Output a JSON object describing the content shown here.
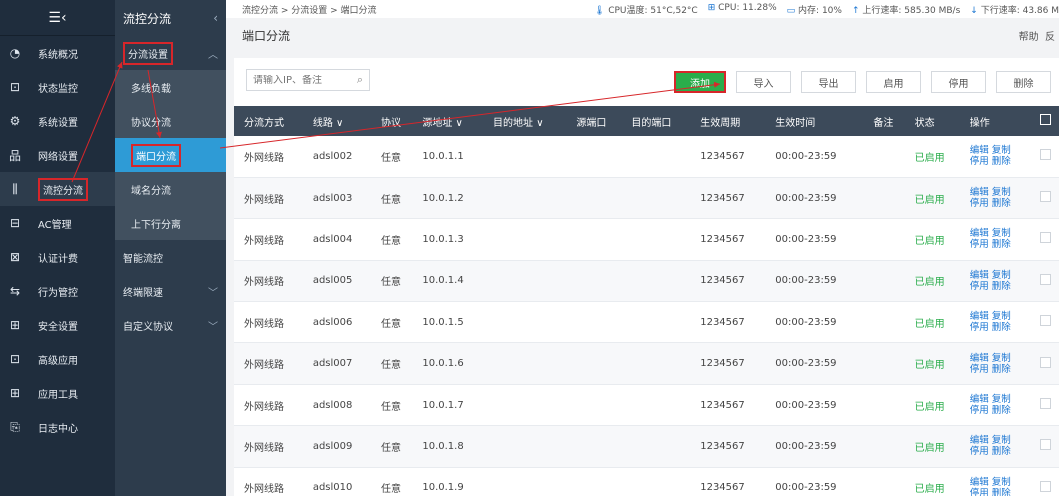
{
  "sidebar": {
    "menu_icon": "collapse-menu-icon",
    "items": [
      {
        "label": "系统概况",
        "icon": "dashboard-icon"
      },
      {
        "label": "状态监控",
        "icon": "monitor-icon"
      },
      {
        "label": "系统设置",
        "icon": "gear-icon"
      },
      {
        "label": "网络设置",
        "icon": "network-icon"
      },
      {
        "label": "流控分流",
        "icon": "flow-control-icon"
      },
      {
        "label": "AC管理",
        "icon": "ac-icon"
      },
      {
        "label": "认证计费",
        "icon": "auth-icon"
      },
      {
        "label": "行为管控",
        "icon": "behavior-icon"
      },
      {
        "label": "安全设置",
        "icon": "security-icon"
      },
      {
        "label": "高级应用",
        "icon": "advanced-icon"
      },
      {
        "label": "应用工具",
        "icon": "tools-icon"
      },
      {
        "label": "日志中心",
        "icon": "log-icon"
      }
    ]
  },
  "subnav": {
    "title": "流控分流",
    "section1": "分流设置",
    "sub_items": [
      "多线负载",
      "协议分流",
      "端口分流",
      "域名分流",
      "上下行分离"
    ],
    "section2": "智能流控",
    "section3": "终端限速",
    "section4": "自定义协议"
  },
  "topbar": {
    "breadcrumb": "流控分流 > 分流设置 > 端口分流",
    "cpu_temp": "CPU温度: 51°C,52°C",
    "cpu": "CPU: 11.28%",
    "mem": "内存: 10%",
    "up": "上行速率: 585.30 MB/s",
    "down": "下行速率: 43.86 M"
  },
  "title": "端口分流",
  "help": "帮助",
  "help_tail": "反",
  "search": {
    "placeholder": "请输入IP、备注"
  },
  "buttons": {
    "add": "添加",
    "import": "导入",
    "export": "导出",
    "enable": "启用",
    "disable": "停用",
    "delete": "删除"
  },
  "columns": [
    "分流方式",
    "线路 ∨",
    "协议",
    "源地址 ∨",
    "目的地址 ∨",
    "源端口",
    "目的端口",
    "生效周期",
    "生效时间",
    "备注",
    "状态",
    "操作"
  ],
  "rows": [
    {
      "mode": "外网线路",
      "line": "adsl002",
      "proto": "任意",
      "src": "10.0.1.1",
      "period": "1234567",
      "time": "00:00-23:59",
      "status": "已启用"
    },
    {
      "mode": "外网线路",
      "line": "adsl003",
      "proto": "任意",
      "src": "10.0.1.2",
      "period": "1234567",
      "time": "00:00-23:59",
      "status": "已启用"
    },
    {
      "mode": "外网线路",
      "line": "adsl004",
      "proto": "任意",
      "src": "10.0.1.3",
      "period": "1234567",
      "time": "00:00-23:59",
      "status": "已启用"
    },
    {
      "mode": "外网线路",
      "line": "adsl005",
      "proto": "任意",
      "src": "10.0.1.4",
      "period": "1234567",
      "time": "00:00-23:59",
      "status": "已启用"
    },
    {
      "mode": "外网线路",
      "line": "adsl006",
      "proto": "任意",
      "src": "10.0.1.5",
      "period": "1234567",
      "time": "00:00-23:59",
      "status": "已启用"
    },
    {
      "mode": "外网线路",
      "line": "adsl007",
      "proto": "任意",
      "src": "10.0.1.6",
      "period": "1234567",
      "time": "00:00-23:59",
      "status": "已启用"
    },
    {
      "mode": "外网线路",
      "line": "adsl008",
      "proto": "任意",
      "src": "10.0.1.7",
      "period": "1234567",
      "time": "00:00-23:59",
      "status": "已启用"
    },
    {
      "mode": "外网线路",
      "line": "adsl009",
      "proto": "任意",
      "src": "10.0.1.8",
      "period": "1234567",
      "time": "00:00-23:59",
      "status": "已启用"
    },
    {
      "mode": "外网线路",
      "line": "adsl010",
      "proto": "任意",
      "src": "10.0.1.9",
      "period": "1234567",
      "time": "00:00-23:59",
      "status": "已启用"
    }
  ],
  "ops": {
    "edit": "编辑",
    "copy": "复制",
    "disable": "停用",
    "delete": "删除"
  },
  "colors": {
    "accent": "#2e9bd6",
    "add_green": "#2aad4b",
    "highlight_red": "#d7262a",
    "sidebar": "#1f2d3d"
  }
}
